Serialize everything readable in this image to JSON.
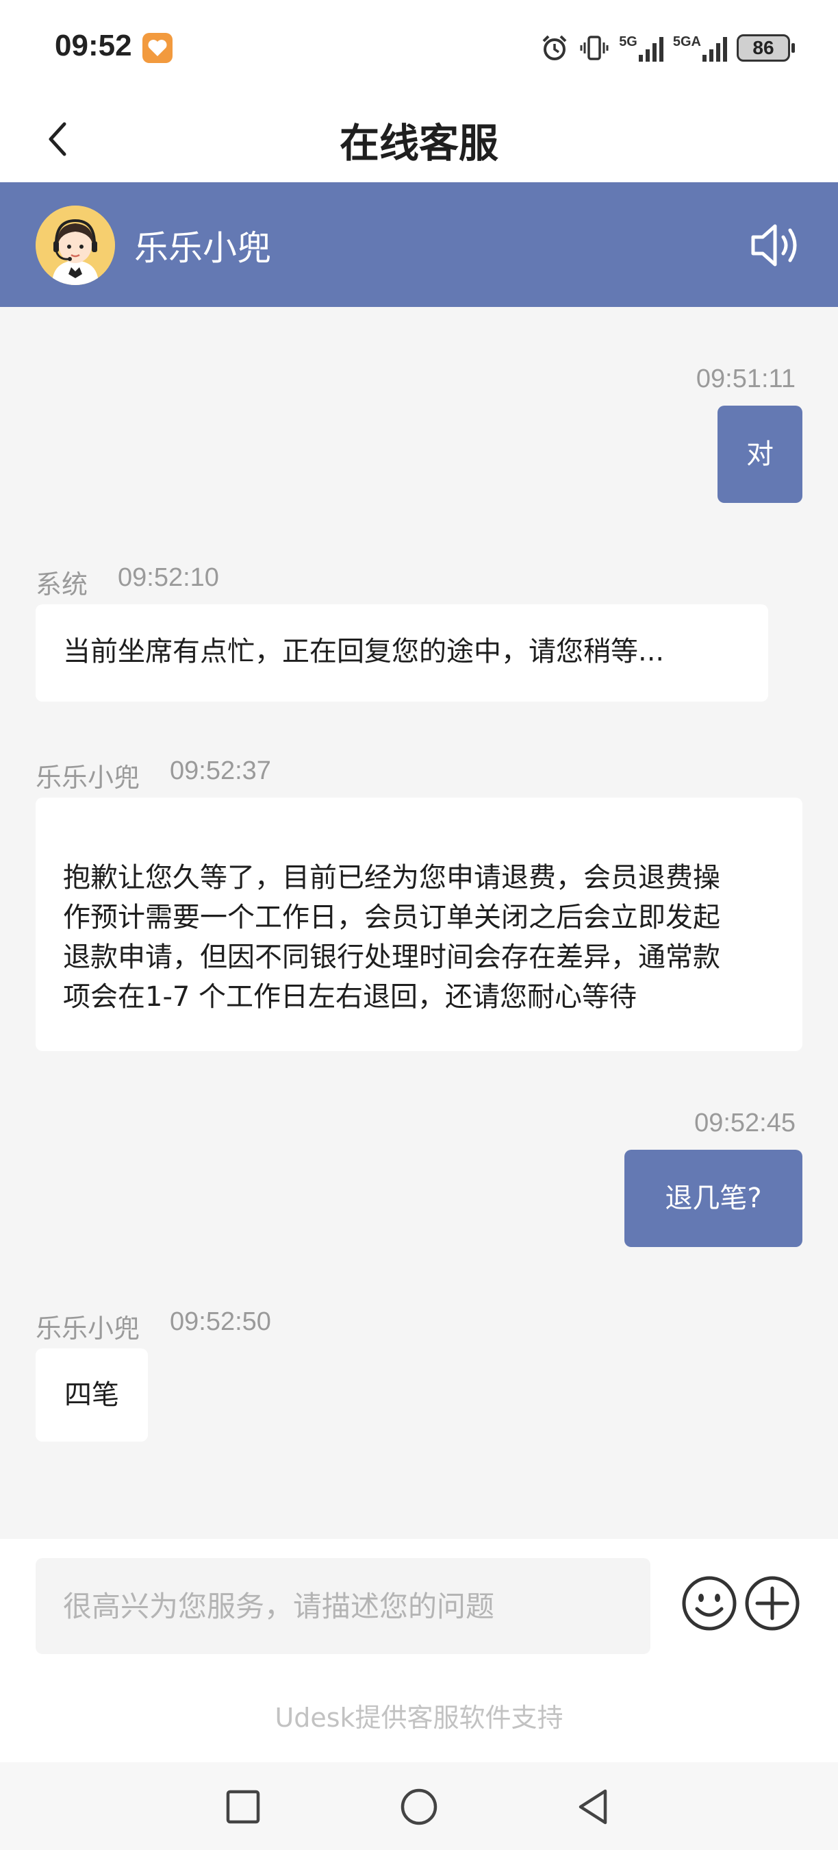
{
  "status_bar": {
    "time": "09:52",
    "signal_1": "5G",
    "signal_2": "5GA",
    "battery": "86"
  },
  "header": {
    "title": "在线客服",
    "back_icon": "chevron-left-icon"
  },
  "agent": {
    "name": "乐乐小兜",
    "avatar_icon": "headset-agent-avatar",
    "speaker_icon": "speaker-icon"
  },
  "messages": [
    {
      "direction": "outgoing",
      "time": "09:51:11",
      "text": "对"
    },
    {
      "direction": "incoming",
      "sender": "系统",
      "time": "09:52:10",
      "text": "当前坐席有点忙，正在回复您的途中，请您稍等..."
    },
    {
      "direction": "incoming",
      "sender": "乐乐小兜",
      "time": "09:52:37",
      "lines": [
        "抱歉让您久等了，目前已经为您申请退费，会员退费操",
        "作预计需要一个工作日，会员订单关闭之后会立即发起",
        "退款申请，但因不同银行处理时间会存在差异，通常款",
        "项会在1-7 个工作日左右退回，还请您耐心等待"
      ]
    },
    {
      "direction": "outgoing",
      "time": "09:52:45",
      "text": "退几笔?"
    },
    {
      "direction": "incoming",
      "sender": "乐乐小兜",
      "time": "09:52:50",
      "text": "四笔"
    }
  ],
  "composer": {
    "placeholder": "很高兴为您服务，请描述您的问题",
    "value": "",
    "emoji_icon": "smiley-icon",
    "plus_icon": "plus-circle-icon",
    "powered_by": "Udesk提供客服软件支持"
  },
  "nav": {
    "recents_icon": "square-icon",
    "home_icon": "circle-icon",
    "back_icon": "triangle-back-icon"
  },
  "colors": {
    "accent": "#6479b3",
    "background": "#f5f5f5",
    "bubble_incoming": "#ffffff"
  }
}
